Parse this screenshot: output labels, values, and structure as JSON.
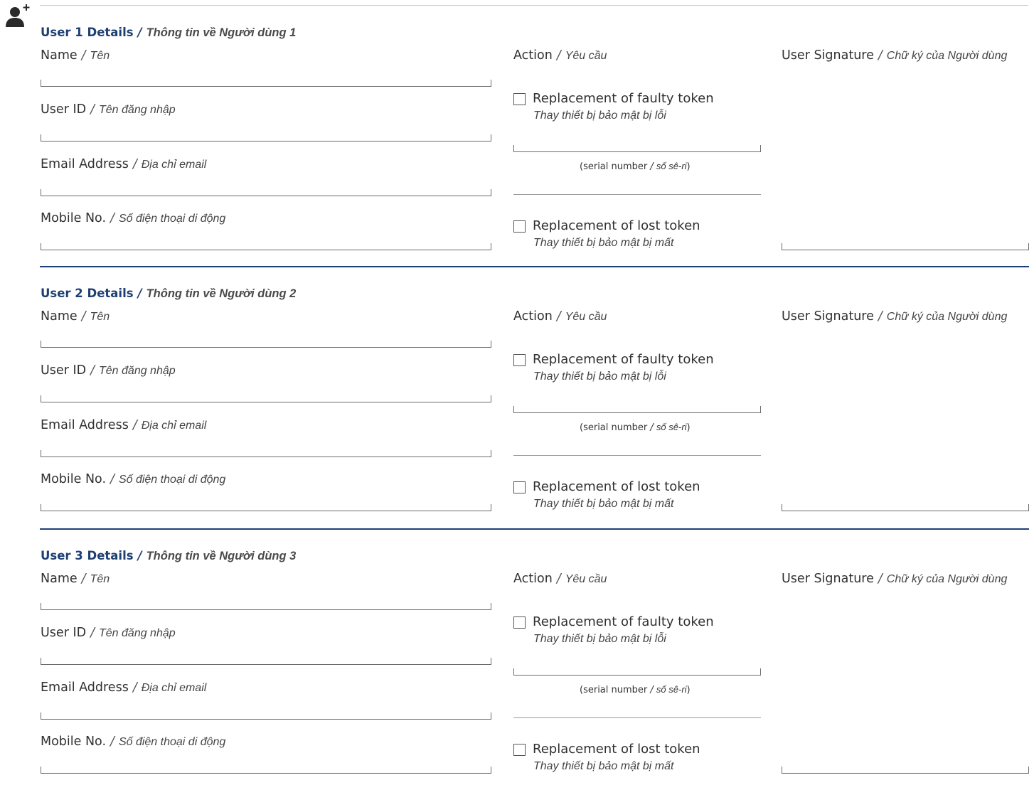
{
  "labels": {
    "name_en": "Name",
    "name_vi": "Tên",
    "userid_en": "User ID",
    "userid_vi": "Tên đăng nhập",
    "email_en": "Email Address",
    "email_vi": "Địa chỉ email",
    "mobile_en": "Mobile No.",
    "mobile_vi": "Số điện thoại di động",
    "action_en": "Action",
    "action_vi": "Yêu cầu",
    "signature_en": "User Signature",
    "signature_vi": "Chữ ký của Người dùng",
    "faulty_en": "Replacement of faulty token",
    "faulty_vi": "Thay thiết bị bảo mật bị lỗi",
    "lost_en": "Replacement of lost token",
    "lost_vi": "Thay thiết bị bảo mật bị mất",
    "serial_en": "serial number",
    "serial_vi": "số sê-ri",
    "separator": "/"
  },
  "users": [
    {
      "title_en": "User 1 Details",
      "title_vi": "Thông tin về Người dùng 1"
    },
    {
      "title_en": "User 2 Details",
      "title_vi": "Thông tin về Người dùng 2"
    },
    {
      "title_en": "User 3 Details",
      "title_vi": "Thông tin về Người dùng 3"
    }
  ],
  "colors": {
    "accent": "#1e3f73"
  },
  "icons": {
    "header": "add-user-icon"
  }
}
